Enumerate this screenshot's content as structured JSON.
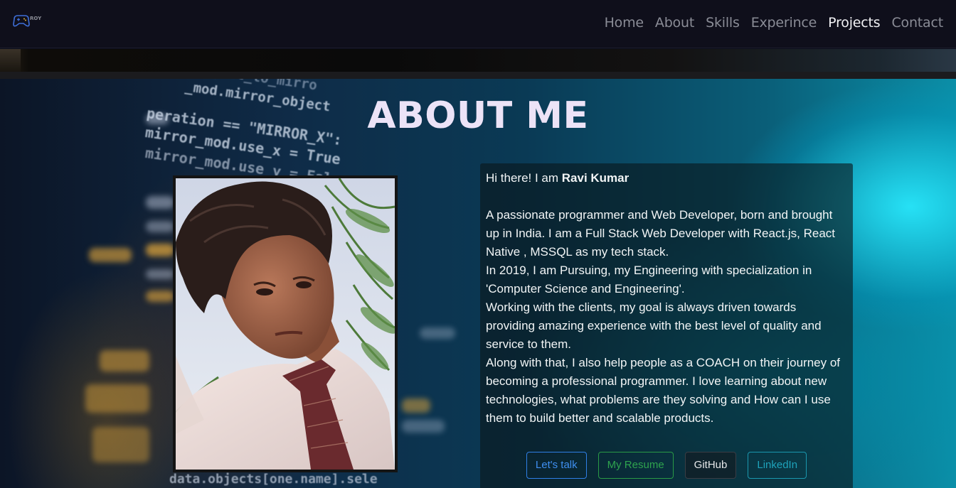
{
  "brand": {
    "logo_icon": "gamepad-icon",
    "logo_text": "ROY"
  },
  "nav": {
    "items": [
      {
        "label": "Home"
      },
      {
        "label": "About"
      },
      {
        "label": "Skills"
      },
      {
        "label": "Experince"
      },
      {
        "label": "Projects",
        "active": true
      },
      {
        "label": "Contact"
      }
    ]
  },
  "about": {
    "title": "ABOUT ME",
    "intro_prefix": "Hi there! I am ",
    "name": "Ravi Kumar",
    "paragraphs": [
      "A passionate programmer and Web Developer, born and brought up in India. I am a Full Stack Web Developer with React.js, React Native , MSSQL as my tech stack.",
      "In 2019, I am Pursuing, my Engineering with specialization in 'Computer Science and Engineering'.",
      "Working with the clients, my goal is always driven towards providing amazing experience with the best level of quality and service to them.",
      "Along with that, I also help people as a COACH on their journey of becoming a professional programmer. I love learning about new technologies, what problems are they solving and How can I use them to build better and scalable products."
    ],
    "buttons": {
      "talk": "Let's talk",
      "resume": "My Resume",
      "github": "GitHub",
      "linkedin": "LinkedIn"
    },
    "background_code": [
      "ject_to_mirro",
      "_mod.mirror_object",
      "peration == \"MIRROR_X\":",
      "mirror_mod.use_x = True",
      "mirror_mod.use_y = False",
      "data.objects[one.name].sele"
    ]
  },
  "colors": {
    "nav_bg": "#0f0f1b",
    "title": "#ece3f7",
    "btn_primary": "#2f7fe6",
    "btn_success": "#2a9a46",
    "btn_info": "#1a97ae"
  }
}
